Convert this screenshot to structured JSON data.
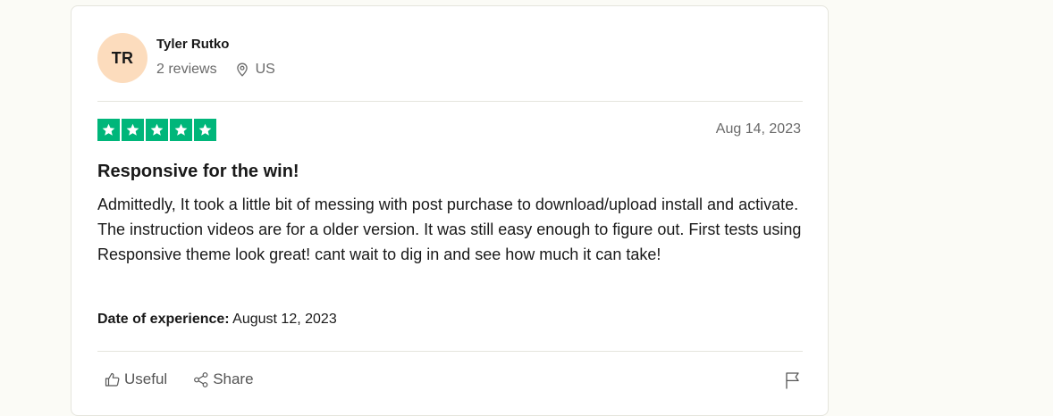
{
  "review": {
    "consumer": {
      "initials": "TR",
      "name": "Tyler Rutko",
      "reviews_count": "2 reviews",
      "country": "US",
      "avatar_color": "#fcdcbd"
    },
    "rating": 5,
    "rating_max": 5,
    "star_color": "#00b67a",
    "date": "Aug 14, 2023",
    "title": "Responsive for the win!",
    "body": "Admittedly, It took a little bit of messing with post purchase to download/upload install and activate. The instruction videos are for a older version. It was still easy enough to figure out. First tests using Responsive theme look great! cant wait to dig in and see how much it can take!",
    "experience_label": "Date of experience:",
    "experience_date": " August 12, 2023",
    "actions": {
      "useful_label": "Useful",
      "share_label": "Share"
    },
    "icons": [
      "location-pin-icon",
      "star-icon",
      "thumbs-up-icon",
      "share-icon",
      "flag-icon"
    ]
  }
}
